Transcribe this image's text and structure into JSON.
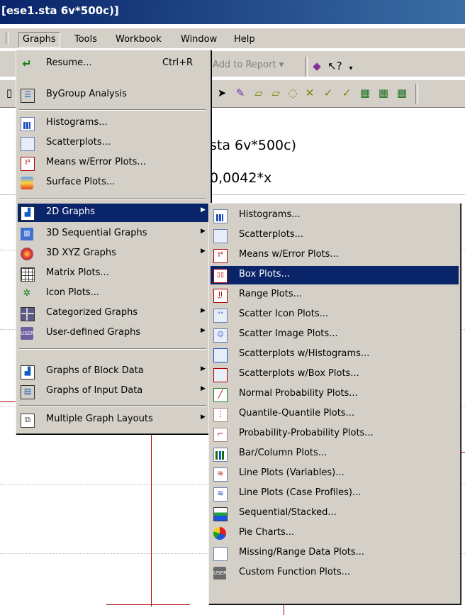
{
  "window": {
    "title": "[ese1.sta 6v*500c)]"
  },
  "menubar": {
    "items": [
      {
        "label": "Graphs"
      },
      {
        "label": "Tools"
      },
      {
        "label": "Workbook"
      },
      {
        "label": "Window"
      },
      {
        "label": "Help"
      }
    ]
  },
  "toolbar": {
    "add_to_report": "Add to Report ▾"
  },
  "document": {
    "header_line1": "sta 6v*500c)",
    "header_line2": "0,0042*x"
  },
  "graphs_menu": {
    "items": [
      {
        "label": "Resume...",
        "shortcut": "Ctrl+R",
        "icon": "resume-icon"
      },
      {
        "label": "ByGroup Analysis",
        "icon": "bygroup-icon"
      },
      {
        "label": "Histograms...",
        "icon": "histogram-icon"
      },
      {
        "label": "Scatterplots...",
        "icon": "scatterplot-icon"
      },
      {
        "label": "Means w/Error Plots...",
        "icon": "means-error-icon"
      },
      {
        "label": "Surface Plots...",
        "icon": "surface-icon"
      },
      {
        "label": "2D Graphs",
        "icon": "2d-graphs-icon",
        "submenu": true,
        "highlighted": true
      },
      {
        "label": "3D Sequential Graphs",
        "icon": "3d-sequential-icon",
        "submenu": true
      },
      {
        "label": "3D XYZ Graphs",
        "icon": "3d-xyz-icon",
        "submenu": true
      },
      {
        "label": "Matrix Plots...",
        "icon": "matrix-icon"
      },
      {
        "label": "Icon Plots...",
        "icon": "icon-plots-icon"
      },
      {
        "label": "Categorized Graphs",
        "icon": "categorized-icon",
        "submenu": true
      },
      {
        "label": "User-defined Graphs",
        "icon": "user-defined-icon",
        "submenu": true
      },
      {
        "label": "Graphs of Block Data",
        "icon": "block-data-icon",
        "submenu": true
      },
      {
        "label": "Graphs of Input Data",
        "icon": "input-data-icon",
        "submenu": true
      },
      {
        "label": "Multiple Graph Layouts",
        "icon": "layouts-icon",
        "submenu": true
      }
    ]
  },
  "submenu_2d": {
    "items": [
      {
        "label": "Histograms...",
        "icon": "histogram-icon"
      },
      {
        "label": "Scatterplots...",
        "icon": "scatterplot-icon"
      },
      {
        "label": "Means w/Error Plots...",
        "icon": "means-error-icon"
      },
      {
        "label": "Box Plots...",
        "icon": "box-plot-icon",
        "highlighted": true
      },
      {
        "label": "Range Plots...",
        "icon": "range-plot-icon"
      },
      {
        "label": "Scatter Icon Plots...",
        "icon": "scatter-icon-plot-icon"
      },
      {
        "label": "Scatter Image Plots...",
        "icon": "scatter-image-icon"
      },
      {
        "label": "Scatterplots w/Histograms...",
        "icon": "scatter-hist-icon"
      },
      {
        "label": "Scatterplots w/Box Plots...",
        "icon": "scatter-box-icon"
      },
      {
        "label": "Normal Probability Plots...",
        "icon": "normal-prob-icon"
      },
      {
        "label": "Quantile-Quantile Plots...",
        "icon": "qq-icon"
      },
      {
        "label": "Probability-Probability Plots...",
        "icon": "pp-icon"
      },
      {
        "label": "Bar/Column Plots...",
        "icon": "bar-column-icon"
      },
      {
        "label": "Line Plots (Variables)...",
        "icon": "line-vars-icon"
      },
      {
        "label": "Line Plots (Case Profiles)...",
        "icon": "line-case-icon"
      },
      {
        "label": "Sequential/Stacked...",
        "icon": "sequential-icon"
      },
      {
        "label": "Pie Charts...",
        "icon": "pie-icon"
      },
      {
        "label": "Missing/Range Data Plots...",
        "icon": "missing-range-icon"
      },
      {
        "label": "Custom Function Plots...",
        "icon": "custom-function-icon"
      }
    ]
  }
}
